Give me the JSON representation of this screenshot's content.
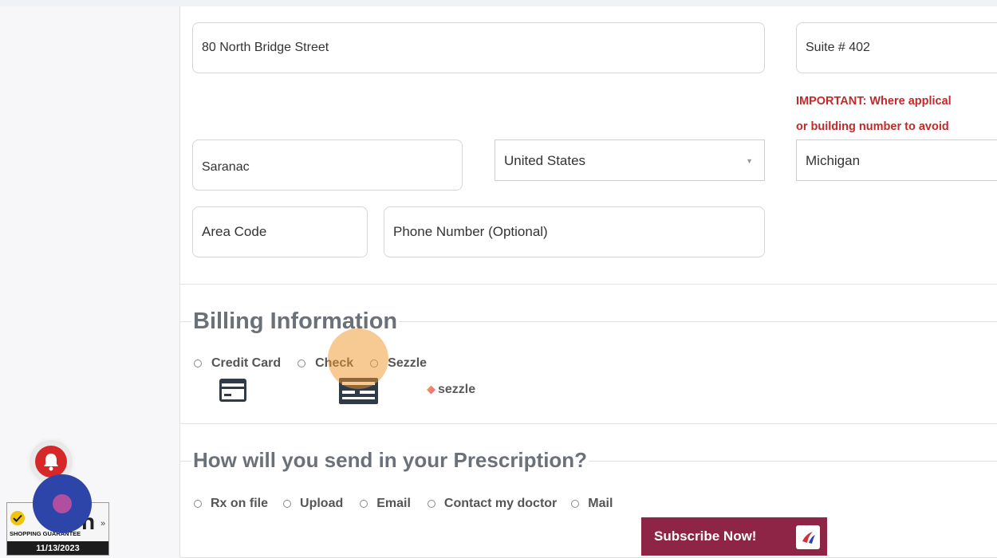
{
  "shipping": {
    "address_line1": "80 North Bridge Street",
    "address_line2": "Suite # 402",
    "important_line1": "IMPORTANT: Where applical",
    "important_line2": "or building number to avoid",
    "city": "Saranac",
    "country": "United States",
    "state": "Michigan",
    "area_code_placeholder": "Area Code",
    "phone_placeholder": "Phone Number (Optional)"
  },
  "billing": {
    "title": "Billing Information",
    "options": [
      {
        "label": "Credit Card",
        "icon": "credit-card-icon"
      },
      {
        "label": "Check",
        "icon": "check-icon"
      },
      {
        "label": "Sezzle",
        "icon": "sezzle-logo"
      }
    ],
    "sezzle_logo_text": "sezzle"
  },
  "prescription": {
    "title": "How will you send in your Prescription?",
    "options": [
      "Rx on file",
      "Upload",
      "Email",
      "Contact my doctor",
      "Mail"
    ]
  },
  "badge": {
    "brand": "n",
    "arrows": "»",
    "guarantee": "SHOPPING GUARANTEE",
    "date": "11/13/2023"
  },
  "subscribe": {
    "label": "Subscribe Now!"
  },
  "colors": {
    "important_red": "#c12a2a",
    "subscribe_bg": "#8e2546",
    "fab_blue": "#2d44a8",
    "bell_red": "#d62828"
  }
}
